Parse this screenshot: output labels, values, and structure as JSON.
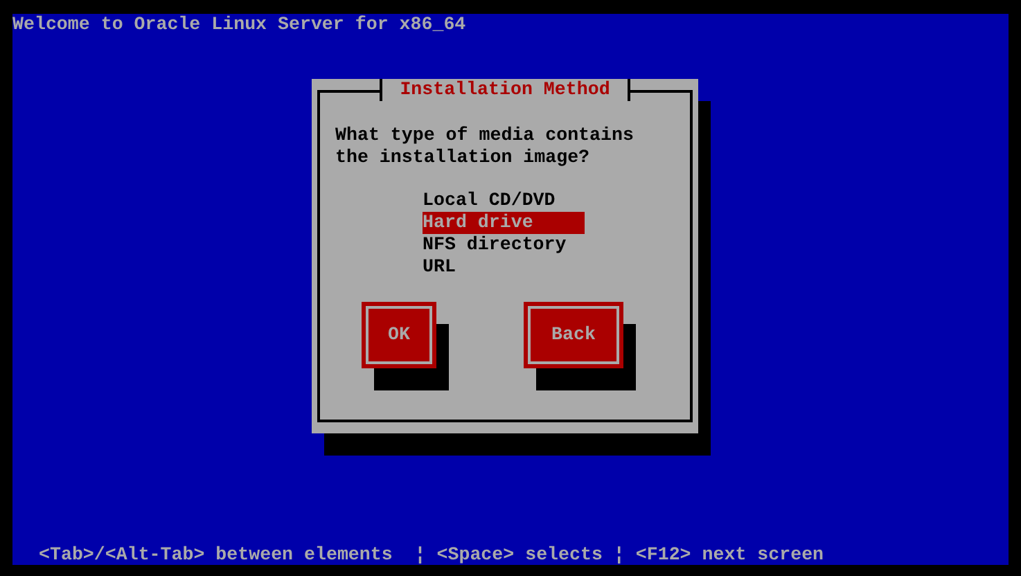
{
  "header": {
    "title": "Welcome to Oracle Linux Server for x86_64"
  },
  "dialog": {
    "title": "Installation Method",
    "question": "What type of media contains\nthe installation image?",
    "options": [
      {
        "label": "Local CD/DVD",
        "selected": false
      },
      {
        "label": "Hard drive",
        "selected": true
      },
      {
        "label": "NFS directory",
        "selected": false
      },
      {
        "label": "URL",
        "selected": false
      }
    ],
    "buttons": [
      "OK",
      "Back"
    ]
  },
  "status_bar": "<Tab>/<Alt-Tab> between elements  ¦ <Space> selects ¦ <F12> next screen"
}
